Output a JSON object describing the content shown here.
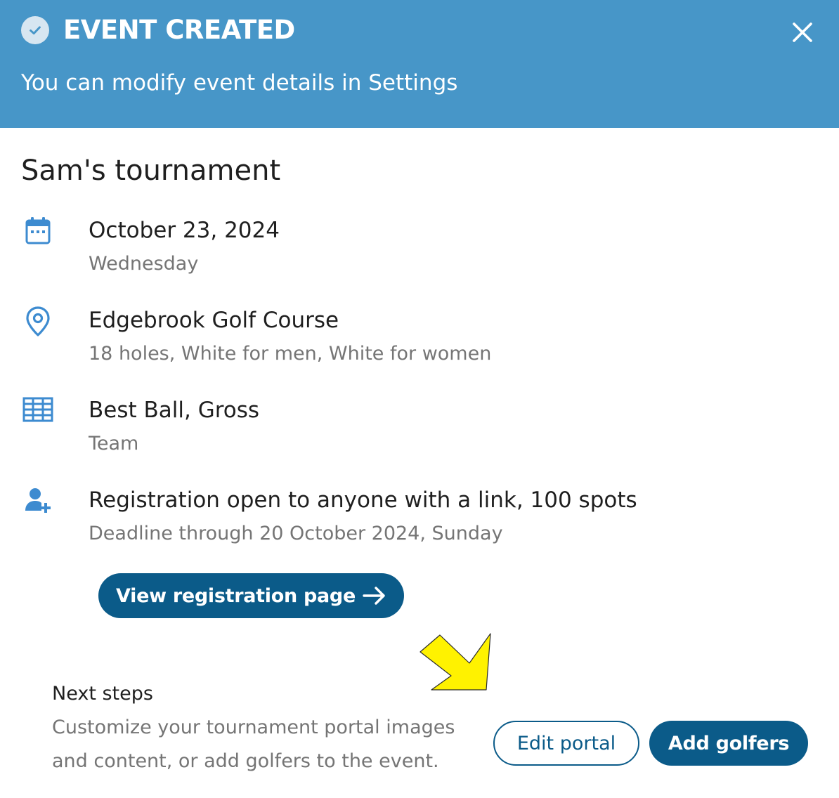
{
  "header": {
    "title": "EVENT CREATED",
    "subtitle": "You can modify event details in Settings",
    "background_color": "#4796c8",
    "status_icon": "check-circle-icon",
    "close_icon": "close-icon"
  },
  "event": {
    "name": "Sam's tournament",
    "details": [
      {
        "icon": "calendar-icon",
        "primary": "October 23, 2024",
        "secondary": "Wednesday"
      },
      {
        "icon": "map-pin-icon",
        "primary": "Edgebrook Golf Course",
        "secondary": "18 holes, White for men, White for women"
      },
      {
        "icon": "grid-table-icon",
        "primary": "Best Ball, Gross",
        "secondary": "Team"
      },
      {
        "icon": "add-person-icon",
        "primary": "Registration open to anyone with a link, 100 spots",
        "secondary": "Deadline through 20 October 2024, Sunday"
      }
    ]
  },
  "actions": {
    "view_registration_label": "View registration page",
    "view_registration_icon": "arrow-right-icon",
    "edit_portal_label": "Edit portal",
    "add_golfers_label": "Add golfers"
  },
  "next_steps": {
    "title": "Next steps",
    "description": "Customize your tournament portal images and content, or add golfers to the event."
  },
  "colors": {
    "primary_button": "#0b5b89",
    "icon_blue": "#3d8bd0",
    "annotation_arrow": "#fff200"
  }
}
